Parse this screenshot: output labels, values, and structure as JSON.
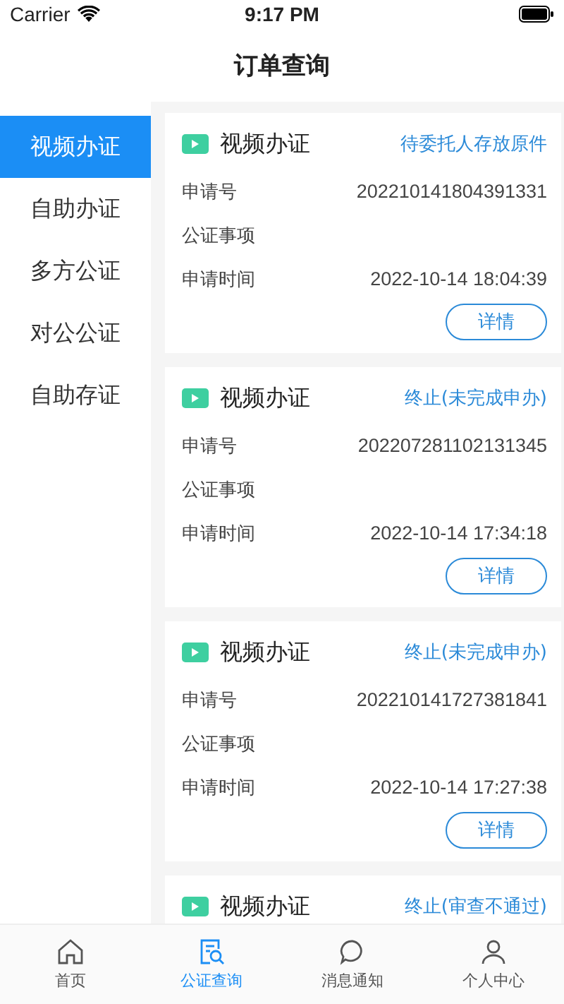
{
  "status_bar": {
    "carrier": "Carrier",
    "time": "9:17 PM"
  },
  "nav": {
    "title": "订单查询"
  },
  "sidebar": {
    "items": [
      {
        "label": "视频办证",
        "selected": true
      },
      {
        "label": "自助办证",
        "selected": false
      },
      {
        "label": "多方公证",
        "selected": false
      },
      {
        "label": "对公公证",
        "selected": false
      },
      {
        "label": "自助存证",
        "selected": false
      }
    ]
  },
  "orders": [
    {
      "type": "视频办证",
      "status": "待委托人存放原件",
      "fields": [
        {
          "label": "申请号",
          "value": "202210141804391331"
        },
        {
          "label": "公证事项"
        },
        {
          "label": "申请时间",
          "value": "2022-10-14 18:04:39"
        }
      ],
      "button": "详情"
    },
    {
      "type": "视频办证",
      "status": "终止(未完成申办)",
      "fields": [
        {
          "label": "申请号",
          "value": "202207281102131345"
        },
        {
          "label": "公证事项"
        },
        {
          "label": "申请时间",
          "value": "2022-10-14 17:34:18"
        }
      ],
      "button": "详情"
    },
    {
      "type": "视频办证",
      "status": "终止(未完成申办)",
      "fields": [
        {
          "label": "申请号",
          "value": "202210141727381841"
        },
        {
          "label": "公证事项"
        },
        {
          "label": "申请时间",
          "value": "2022-10-14 17:27:38"
        }
      ],
      "button": "详情"
    },
    {
      "type": "视频办证",
      "status": "终止(审查不通过)"
    }
  ],
  "tab_bar": [
    {
      "label": "首页",
      "kind": "home",
      "selected": false
    },
    {
      "label": "公证查询",
      "kind": "query",
      "selected": true
    },
    {
      "label": "消息通知",
      "kind": "message",
      "selected": false
    },
    {
      "label": "个人中心",
      "kind": "person",
      "selected": false
    }
  ]
}
